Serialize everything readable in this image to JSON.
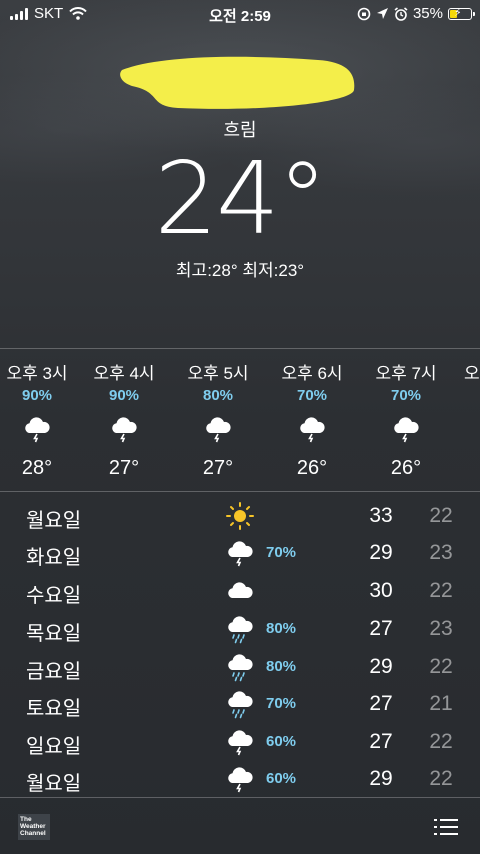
{
  "status_bar": {
    "carrier": "SKT",
    "time": "오전 2:59",
    "battery_percent": "35%",
    "battery_level": 0.35,
    "battery_color": "#f5d90a"
  },
  "current": {
    "condition": "흐림",
    "temperature": "24°",
    "high_low": "최고:28°  최저:23°"
  },
  "hourly": [
    {
      "label": "오후 3시",
      "prob": "90%",
      "icon": "thunderstorm-icon",
      "temp": "28°"
    },
    {
      "label": "오후 4시",
      "prob": "90%",
      "icon": "thunderstorm-icon",
      "temp": "27°"
    },
    {
      "label": "오후 5시",
      "prob": "80%",
      "icon": "thunderstorm-icon",
      "temp": "27°"
    },
    {
      "label": "오후 6시",
      "prob": "70%",
      "icon": "thunderstorm-icon",
      "temp": "26°"
    },
    {
      "label": "오후 7시",
      "prob": "70%",
      "icon": "thunderstorm-icon",
      "temp": "26°"
    },
    {
      "label": "오",
      "prob": "",
      "icon": "",
      "temp": ""
    }
  ],
  "daily": [
    {
      "day": "월요일",
      "icon": "sun-icon",
      "prob": "",
      "high": "33",
      "low": "22"
    },
    {
      "day": "화요일",
      "icon": "thunderstorm-icon",
      "prob": "70%",
      "high": "29",
      "low": "23"
    },
    {
      "day": "수요일",
      "icon": "cloud-icon",
      "prob": "",
      "high": "30",
      "low": "22"
    },
    {
      "day": "목요일",
      "icon": "rain-icon",
      "prob": "80%",
      "high": "27",
      "low": "23"
    },
    {
      "day": "금요일",
      "icon": "rain-icon",
      "prob": "80%",
      "high": "29",
      "low": "22"
    },
    {
      "day": "토요일",
      "icon": "rain-icon",
      "prob": "70%",
      "high": "27",
      "low": "21"
    },
    {
      "day": "일요일",
      "icon": "thunderstorm-icon",
      "prob": "60%",
      "high": "27",
      "low": "22"
    },
    {
      "day": "월요일",
      "icon": "thunderstorm-icon",
      "prob": "60%",
      "high": "29",
      "low": "22"
    }
  ],
  "footer": {
    "logo_text": "The Weather Channel",
    "list_icon": "list-icon"
  },
  "colors": {
    "precip_blue": "#7fcdee",
    "redaction_yellow": "#f4ee4a"
  }
}
